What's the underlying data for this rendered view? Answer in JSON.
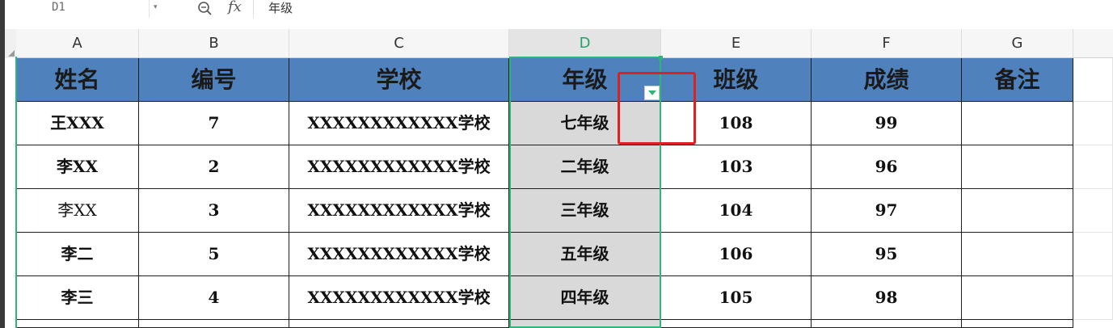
{
  "formula_bar": {
    "cell_ref": "D1",
    "dropdown_icon": "chevron-down-icon",
    "zoom_icon": "zoom-icon",
    "fx_label": "fx",
    "content": "年级"
  },
  "columns": [
    "A",
    "B",
    "C",
    "D",
    "E",
    "F",
    "G"
  ],
  "active_column": "D",
  "table": {
    "headers": [
      "姓名",
      "编号",
      "学校",
      "年级",
      "班级",
      "成绩",
      "备注"
    ],
    "rows": [
      [
        "王XXX",
        "7",
        "XXXXXXXXXXXX学校",
        "七年级",
        "108",
        "99",
        ""
      ],
      [
        "李XX",
        "2",
        "XXXXXXXXXXXX学校",
        "二年级",
        "103",
        "96",
        ""
      ],
      [
        "李XX",
        "3",
        "XXXXXXXXXXXX学校",
        "三年级",
        "104",
        "97",
        ""
      ],
      [
        "李二",
        "5",
        "XXXXXXXXXXXX学校",
        "五年级",
        "106",
        "95",
        ""
      ],
      [
        "李三",
        "4",
        "XXXXXXXXXXXX学校",
        "四年级",
        "105",
        "98",
        ""
      ]
    ]
  },
  "filter_icon": "filter-dropdown-icon",
  "colors": {
    "header_fill": "#4f81bd",
    "selection": "#2fb577",
    "highlight_box": "#e02020",
    "selected_fill": "#d9d9d9"
  }
}
